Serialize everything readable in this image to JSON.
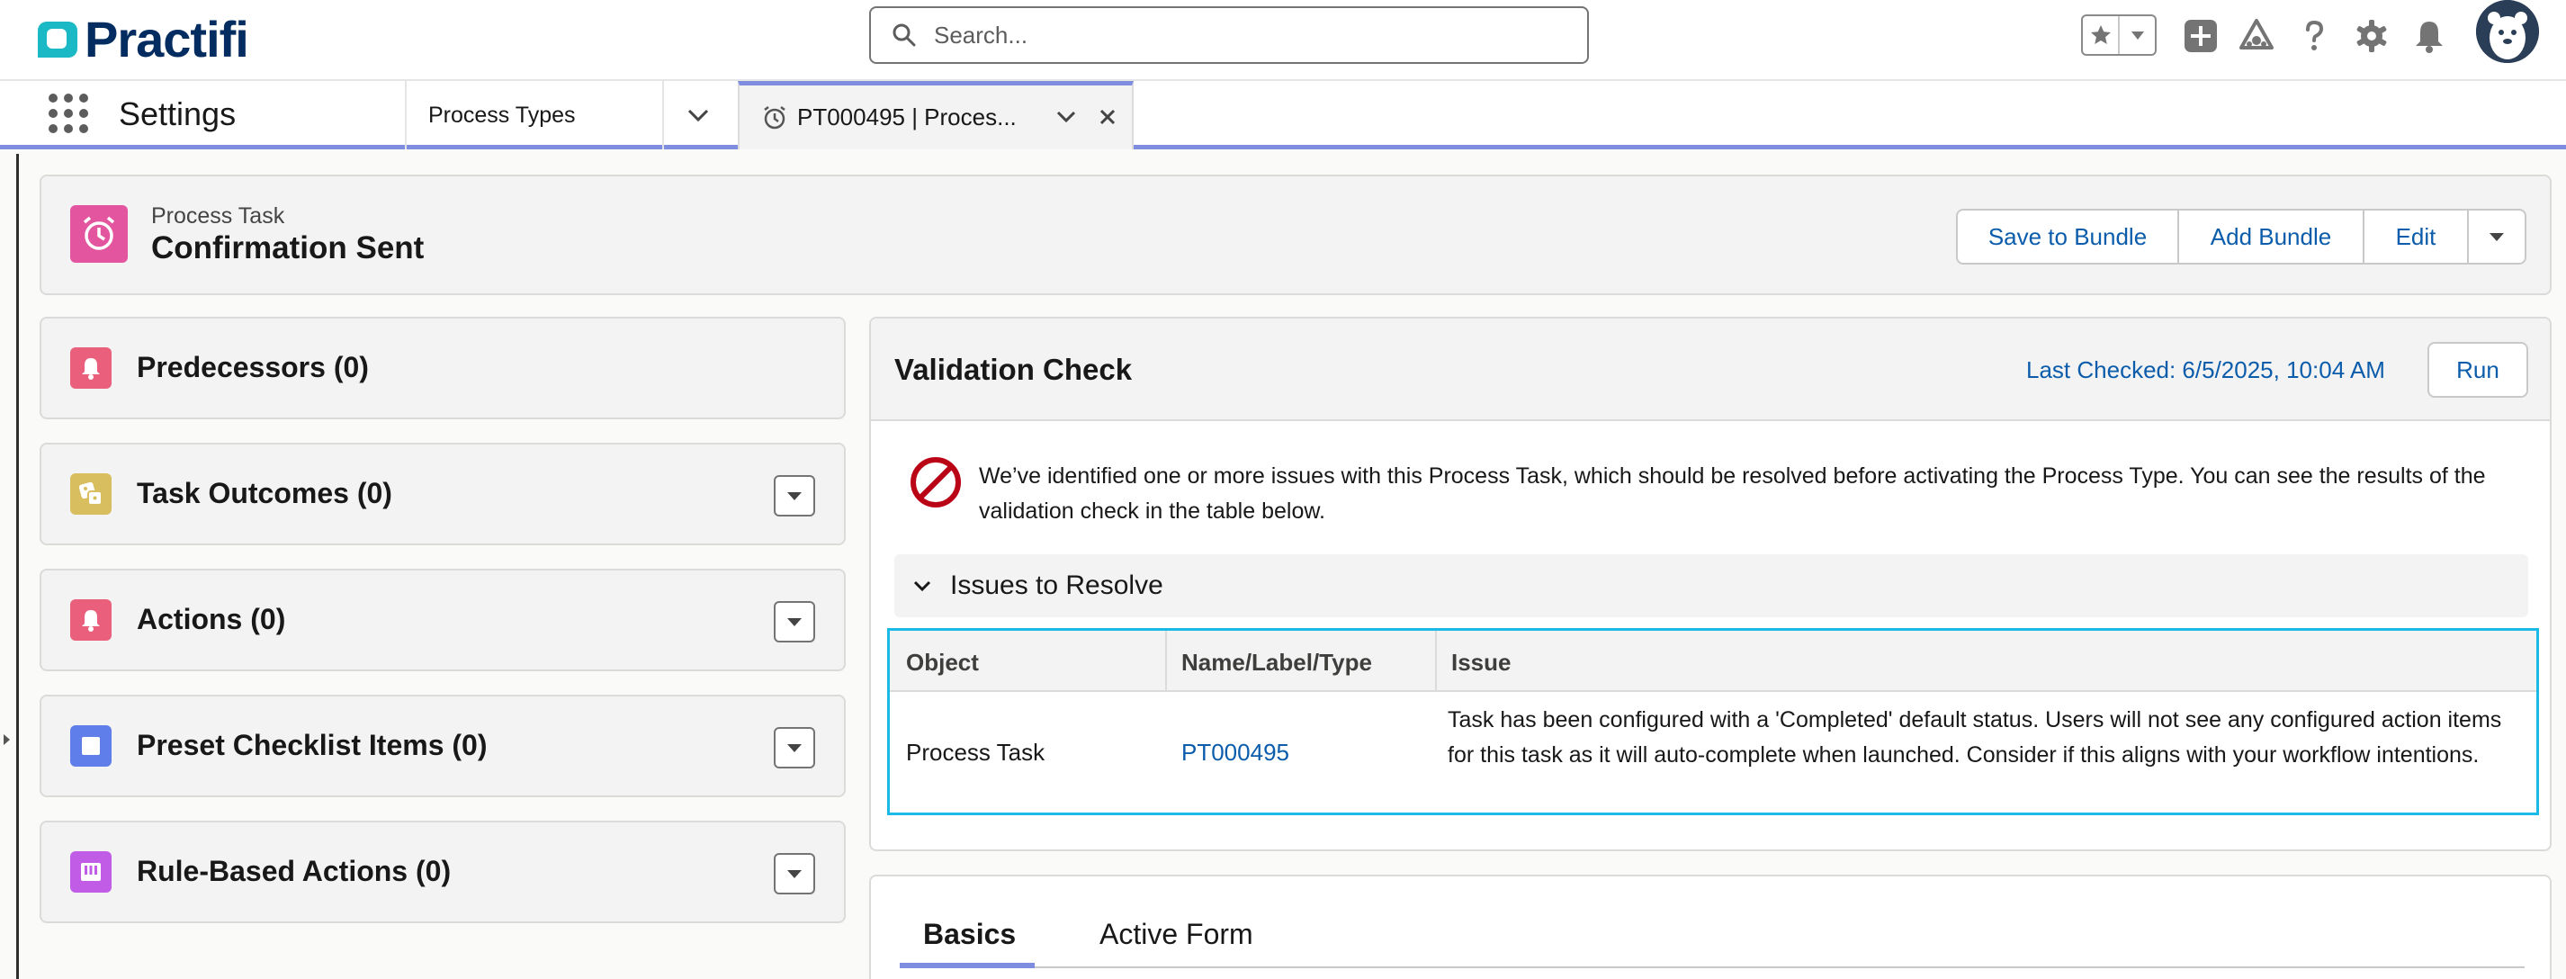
{
  "header": {
    "logo_text": "Practifi",
    "search_placeholder": "Search..."
  },
  "nav": {
    "app_name": "Settings",
    "item_label": "Process Types",
    "active_tab_label": "PT000495 | Proces..."
  },
  "record": {
    "type_label": "Process Task",
    "title": "Confirmation Sent",
    "buttons": {
      "save_to_bundle": "Save to Bundle",
      "add_bundle": "Add Bundle",
      "edit": "Edit"
    }
  },
  "related_lists": [
    {
      "label": "Predecessors (0)",
      "icon": "bell-icon",
      "color": "#ea5f7b"
    },
    {
      "label": "Task Outcomes (0)",
      "icon": "dice-icon",
      "color": "#d8be5f"
    },
    {
      "label": "Actions (0)",
      "icon": "bell-icon",
      "color": "#ea5f7b"
    },
    {
      "label": "Preset Checklist Items (0)",
      "icon": "checkbox-icon",
      "color": "#5f7eea"
    },
    {
      "label": "Rule-Based Actions (0)",
      "icon": "ruleset-icon",
      "color": "#c05ce6"
    }
  ],
  "validation": {
    "title": "Validation Check",
    "last_checked": "Last Checked: 6/5/2025, 10:04 AM",
    "run_label": "Run",
    "message": "We’ve identified one or more issues with this Process Task, which should be resolved before activating the Process Type. You can see the results of the validation check in the table below.",
    "issues_section_label": "Issues to Resolve",
    "table": {
      "headers": [
        "Object",
        "Name/Label/Type",
        "Issue"
      ],
      "rows": [
        {
          "object": "Process Task",
          "name": "PT000495",
          "issue": "Task has been configured with a 'Completed' default status. Users will not see any configured action items for this task as it will auto-complete when launched. Consider if this aligns with your workflow intentions."
        }
      ]
    }
  },
  "detail_tabs": [
    "Basics",
    "Active Form"
  ],
  "colors": {
    "brand_navy": "#032d60",
    "link_blue": "#0b5cab",
    "tab_accent": "#7f8de1",
    "highlight": "#1ab9e8",
    "error_red": "#ba0517",
    "record_icon": "#e3569f"
  }
}
